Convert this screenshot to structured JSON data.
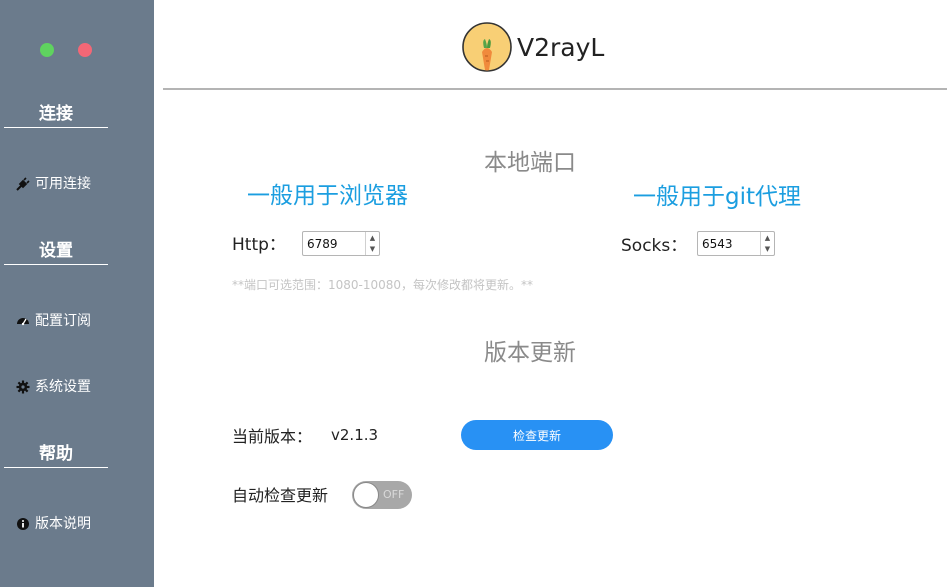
{
  "sidebar": {
    "sections": {
      "connect": "连接",
      "settings": "设置",
      "help": "帮助"
    },
    "items": {
      "available": {
        "label": "可用连接",
        "icon": "plug-icon"
      },
      "subscription": {
        "label": "配置订阅",
        "icon": "dashboard-icon"
      },
      "system": {
        "label": "系统设置",
        "icon": "gear-icon"
      },
      "version": {
        "label": "版本说明",
        "icon": "info-icon"
      }
    },
    "window_buttons": {
      "green": "#5fd35f",
      "red": "#f36776"
    },
    "background": "#6b7b8c"
  },
  "header": {
    "title": "V2rayL",
    "logo_icon": "carrot-logo-icon"
  },
  "local_ports": {
    "heading": "本地端口",
    "http_note": "一般用于浏览器",
    "socks_note": "一般用于git代理",
    "http_label": "Http：",
    "http_value": "6789",
    "socks_label": "Socks：",
    "socks_value": "6543",
    "hint": "**端口可选范围：1080-10080，每次修改都将更新。**"
  },
  "version_update": {
    "heading": "版本更新",
    "current_label": "当前版本：",
    "current_value": "v2.1.3",
    "check_button": "检查更新",
    "auto_label": "自动检查更新",
    "auto_state": "OFF"
  },
  "colors": {
    "accent_blue": "#1b9ee0",
    "button_blue": "#2891f4"
  }
}
